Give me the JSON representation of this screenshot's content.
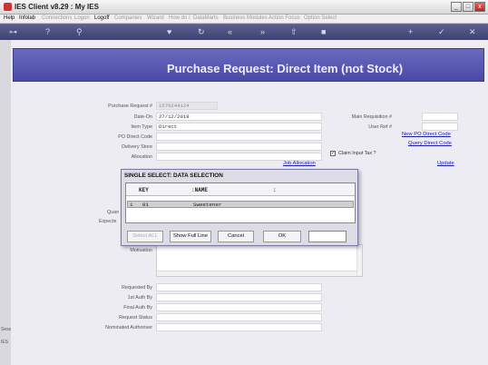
{
  "window": {
    "title": "IES Client v8.29 : My IES",
    "minimize": "_",
    "maximize": "□",
    "close": "x"
  },
  "menu": [
    "Help",
    "Infolab",
    "Connections",
    "Logon",
    "Logoff",
    "Companies",
    "Wizard",
    "How do I",
    "DataMarts",
    "Business Modules",
    "Action Focus",
    "Option Select"
  ],
  "menu_enabled": [
    "Help",
    "Infolab",
    "Logoff"
  ],
  "toolbar": {
    "icons": [
      "key-icon",
      "help-icon",
      "search-icon",
      "heart-icon",
      "refresh-icon",
      "rewind-icon",
      "forward-icon",
      "upload-icon",
      "stop-icon",
      "add-icon",
      "check-icon",
      "close-icon"
    ],
    "glyphs": [
      "⊶",
      "?",
      "⚲",
      "♥",
      "↻",
      "«",
      "»",
      "⇧",
      "■",
      "+",
      "✓",
      "✕"
    ]
  },
  "leftstrip": {
    "labels": [
      "Sess",
      "IES"
    ]
  },
  "header": {
    "title": "Purchase Request: Direct Item (not Stock)"
  },
  "form": {
    "purchase_request_label": "Purchase Request #",
    "purchase_request_value": "1570244124",
    "date_on_label": "Date-On",
    "date_on_value": "27/12/2018",
    "item_type_label": "Item Type",
    "item_type_value": "Direct",
    "po_direct_code_label": "PO Direct Code",
    "delivery_store_label": "Delivery Store",
    "allocation_label": "Allocation",
    "main_requisition_label": "Main Requisition #",
    "user_ref_label": "User Ref #",
    "new_po_link": "New PO Direct Code",
    "query_direct_link": "Query Direct Code",
    "claim_input_tax_label": "Claim Input Tax ?",
    "claim_input_tax_checked": "✓",
    "job_allocation_link": "Job Allocation",
    "update_link": "Update",
    "quantity_label_partial": "Quan",
    "expected_label_partial": "Expecte",
    "motivation_label": "Motivation",
    "requested_by_label": "Requested By",
    "first_auth_label": "1st Auth By",
    "final_auth_label": "Final Auth By",
    "request_status_label": "Request Status",
    "nominated_authoriser_label": "Nominated Authoriser"
  },
  "modal": {
    "title": "SINGLE SELECT: DATA SELECTION",
    "col_key": "KEY",
    "col_name": ":NAME",
    "col_extra": ":",
    "row": {
      "index": "1",
      "key": "01",
      "name": "Sweetener"
    },
    "select_all": "Select ALL",
    "show_full_line": "Show Full Line",
    "cancel": "Cancel",
    "ok": "OK"
  }
}
